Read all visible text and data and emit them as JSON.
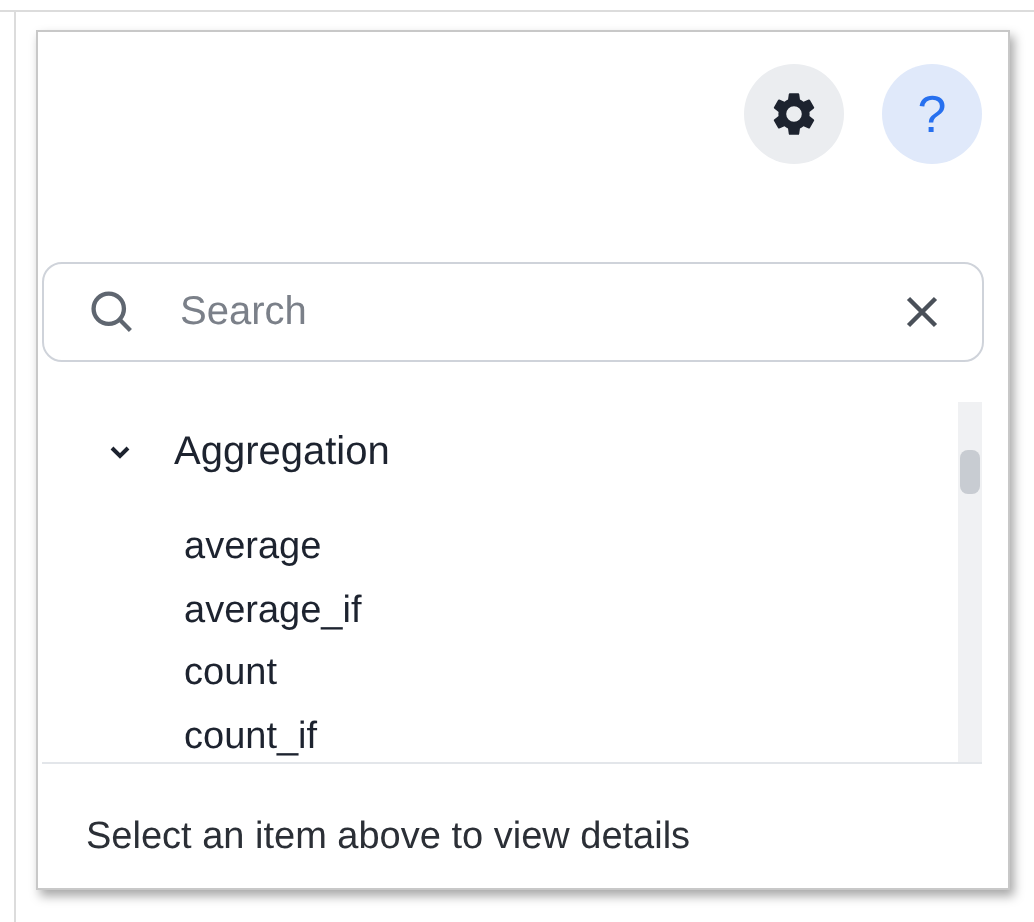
{
  "header": {
    "buttons": [
      {
        "kind": "settings"
      },
      {
        "kind": "help",
        "label": "?"
      }
    ]
  },
  "search": {
    "placeholder": "Search"
  },
  "groups": [
    {
      "title": "Aggregation",
      "expanded": true,
      "items": [
        "average",
        "average_if",
        "count",
        "count_if"
      ]
    }
  ],
  "footer": {
    "text": "Select an item above to view details"
  }
}
